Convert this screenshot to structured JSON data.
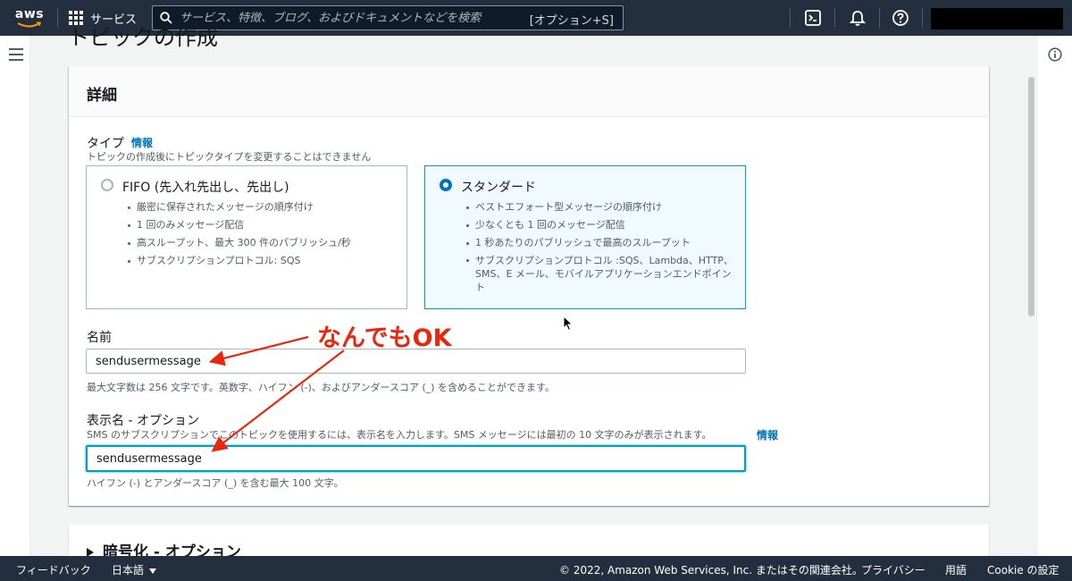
{
  "topnav": {
    "logo_text": "aws",
    "services_label": "サービス",
    "search_placeholder": "サービス、特徴、ブログ、およびドキュメントなどを検索",
    "search_shortcut": "[オプション+S]",
    "icons": [
      "grid-icon",
      "search-icon",
      "cloudshell-icon",
      "bell-icon",
      "help-icon"
    ]
  },
  "page": {
    "title": "トピックの作成"
  },
  "details": {
    "header": "詳細",
    "type_label": "タイプ",
    "type_info": "情報",
    "type_desc": "トピックの作成後にトピックタイプを変更することはできません",
    "fifo": {
      "title": "FIFO (先入れ先出し、先出し)",
      "selected": false,
      "bullets": [
        "厳密に保存されたメッセージの順序付け",
        "1 回のみメッセージ配信",
        "高スループット、最大 300 件のパブリッシュ/秒",
        "サブスクリプションプロトコル: SQS"
      ]
    },
    "standard": {
      "title": "スタンダード",
      "selected": true,
      "bullets": [
        "ベストエフォート型メッセージの順序付け",
        "少なくとも 1 回のメッセージ配信",
        "1 秒あたりのパブリッシュで最高のスループット",
        "サブスクリプションプロトコル :SQS、Lambda、HTTP、SMS、E メール、モバイルアプリケーションエンドポイント"
      ]
    },
    "name_label": "名前",
    "name_value": "sendusermessage",
    "name_hint": "最大文字数は 256 文字です。英数字、ハイフン (-)、およびアンダースコア (_) を含めることができます。",
    "display_label": "表示名 - オプション",
    "display_desc": "SMS のサブスクリプションでこのトピックを使用するには、表示名を入力します。SMS メッセージには最初の 10 文字のみが表示されます。",
    "display_info": "情報",
    "display_value": "sendusermessage",
    "display_hint": "ハイフン (-) とアンダースコア (_) を含む最大 100 文字。"
  },
  "encryption": {
    "label": "暗号化 - オプション"
  },
  "annotation": {
    "text": "なんでもOK",
    "color": "#e8270e"
  },
  "footer": {
    "feedback": "フィードバック",
    "language": "日本語",
    "copyright": "© 2022, Amazon Web Services, Inc. またはその関連会社。",
    "privacy": "プライバシー",
    "terms": "用語",
    "cookie": "Cookie の設定"
  }
}
